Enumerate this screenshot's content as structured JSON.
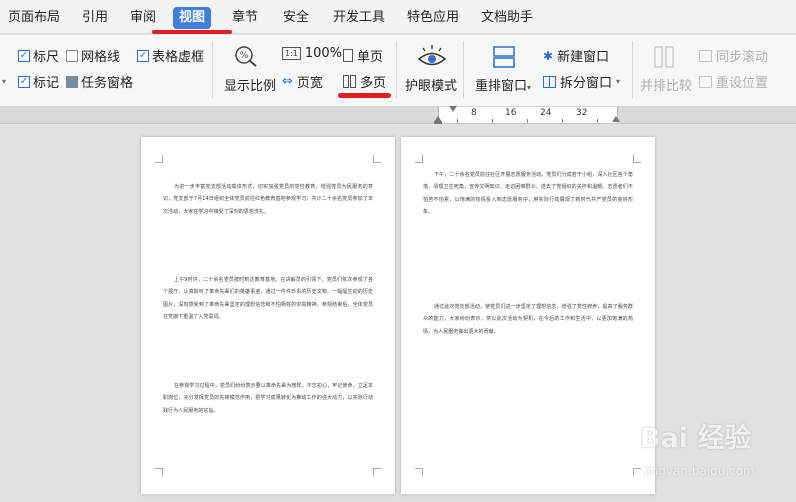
{
  "tabs": [
    {
      "label": "页面布局",
      "active": false
    },
    {
      "label": "引用",
      "active": false
    },
    {
      "label": "审阅",
      "active": false
    },
    {
      "label": "视图",
      "active": true
    },
    {
      "label": "章节",
      "active": false
    },
    {
      "label": "安全",
      "active": false
    },
    {
      "label": "开发工具",
      "active": false
    },
    {
      "label": "特色应用",
      "active": false
    },
    {
      "label": "文档助手",
      "active": false
    }
  ],
  "ribbon": {
    "checkboxes": {
      "ruler": {
        "label": "标尺",
        "checked": true
      },
      "gridlines": {
        "label": "网格线",
        "checked": false
      },
      "table_gridlines": {
        "label": "表格虚框",
        "checked": true
      },
      "marks": {
        "label": "标记",
        "checked": true
      },
      "task_pane": {
        "label": "任务窗格",
        "checked": false
      }
    },
    "zoom_label": "显示比例",
    "zoom_100": "100%",
    "page_width": "页宽",
    "single_page": "单页",
    "multi_page": "多页",
    "eye_mode": "护眼模式",
    "rearrange_window": "重排窗口",
    "new_window": "新建窗口",
    "split_window": "拆分窗口",
    "side_by_side": "并排比较",
    "sync_scroll": "同步滚动",
    "reset_position": "重设位置"
  },
  "ruler": {
    "ticks": [
      "8",
      "16",
      "24",
      "32"
    ]
  },
  "document": {
    "page1": [
      "为进一步丰富党支部活动载体形式，切实加强党员的党性教育，增强党员为民服务的意识，党支部于7月14日组织全体党员前往红色教育基地参观学习，共计二十余名党员参加了本次活动，大家在学习中接受了深刻的思想洗礼。",
      "上午9时许，二十余名党员按时到达教育基地。在讲解员的引领下，党员们依次参观了各个展厅，认真聆听了革命先辈们的英雄事迹，通过一件件珍贵的历史文物、一幅幅生动的历史图片，深刻感受到了革命先辈坚定的理想信念和不怕牺牲的崇高精神。参观结束后，全体党员在党旗下重温了入党誓词。",
      "在参观学习过程中，党员们纷纷表示要以革命先辈为榜样，不忘初心，牢记使命，立足本职岗位，充分发挥党员的先锋模范作用，把学习成果转化为推动工作的强大动力，以实际行动践行为人民服务的宗旨。"
    ],
    "page2": [
      "下午，二十余名党员前往社区开展志愿服务活动。党员们分成若干小组，深入社区各个角落，清理卫生死角，宣传文明知识，走访困难群众，送去了党组织的关怀和温暖。志愿者们不怕苦不怕累，以饱满的热情投入到志愿服务中，用实际行动展现了新时代共产党员的良好形象。",
      "通过此次党支部活动，使党员们进一步坚定了理想信念，增强了党性修养，提高了服务群众的能力，大家纷纷表示，将以此次活动为契机，在今后的工作和生活中，以更加饱满的热情，为人民服务做出更大的贡献。"
    ]
  },
  "watermark": {
    "text": "Bai 经验",
    "url": "jingyan.baidu.com"
  }
}
